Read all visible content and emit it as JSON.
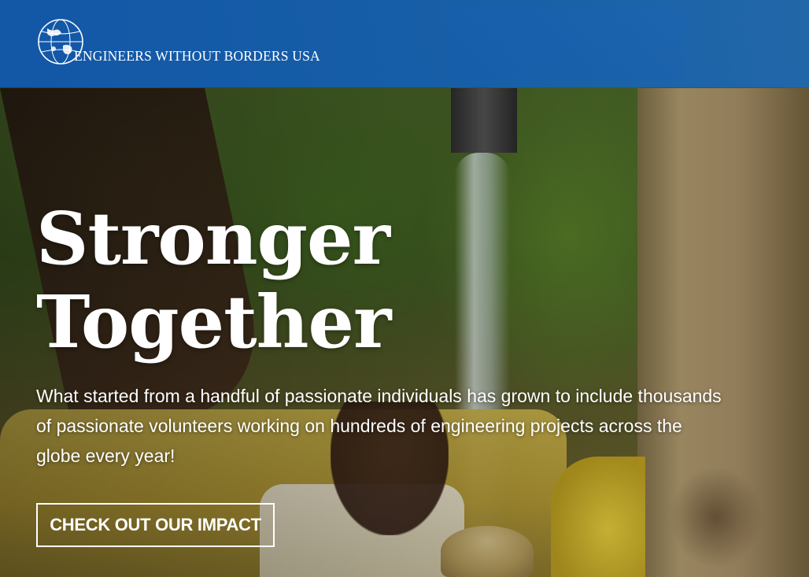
{
  "header": {
    "logo_text": "ENGINEERS WITHOUT BORDERS USA",
    "logo_icon": "globe-icon",
    "brand_color": "#1460b2"
  },
  "hero": {
    "headline_line1": "Stronger",
    "headline_line2": "Together",
    "intro": "What started from a handful of passionate individuals has grown to include thousands of passionate volunteers working on hundreds of engineering projects across the globe every year!",
    "cta_label": "CHECK OUT OUR IMPACT"
  }
}
